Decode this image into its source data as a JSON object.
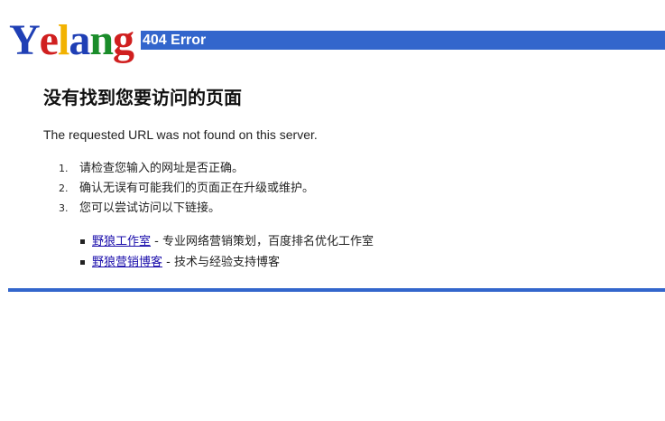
{
  "logo": {
    "letters": [
      {
        "char": "Y",
        "color": "#1f3fb5"
      },
      {
        "char": "e",
        "color": "#d01f1f"
      },
      {
        "char": "l",
        "color": "#f2b200"
      },
      {
        "char": "a",
        "color": "#1f3fb5"
      },
      {
        "char": "n",
        "color": "#1a8c2a"
      },
      {
        "char": "g",
        "color": "#d01f1f"
      }
    ]
  },
  "header": {
    "title": "404 Error",
    "bar_color": "#3366cc"
  },
  "main": {
    "title": "没有找到您要访问的页面",
    "message": "The requested URL was not found on this server.",
    "steps": [
      {
        "num": "1.",
        "text": "请检查您输入的网址是否正确。"
      },
      {
        "num": "2.",
        "text": "确认无误有可能我们的页面正在升级或维护。"
      },
      {
        "num": "3.",
        "text": "您可以尝试访问以下链接。"
      }
    ],
    "links": [
      {
        "label": "野狼工作室",
        "desc": " - 专业网络营销策划，百度排名优化工作室"
      },
      {
        "label": "野狼营销博客",
        "desc": " - 技术与经验支持博客"
      }
    ]
  },
  "colors": {
    "accent": "#3366cc",
    "link": "#1a0dab"
  }
}
